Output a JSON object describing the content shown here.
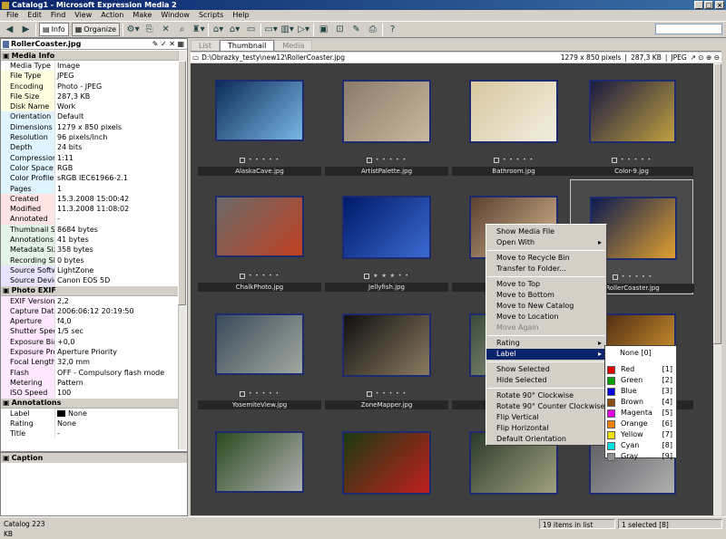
{
  "window": {
    "title": "Catalog1 - Microsoft Expression Media 2"
  },
  "menu": [
    "File",
    "Edit",
    "Find",
    "View",
    "Action",
    "Make",
    "Window",
    "Scripts",
    "Help"
  ],
  "toolbar": {
    "info_label": "Info",
    "organize_label": "Organize"
  },
  "panel": {
    "title": "RollerCoaster.jpg",
    "media_info_title": "Media Info",
    "media_info": [
      {
        "k": "Media Type",
        "v": "Image",
        "c": "#ffffff"
      },
      {
        "k": "File Type",
        "v": "JPEG",
        "c": "#ffffe0"
      },
      {
        "k": "Encoding",
        "v": "Photo - JPEG",
        "c": "#ffffe0"
      },
      {
        "k": "File Size",
        "v": "287,3 KB",
        "c": "#ffffe0"
      },
      {
        "k": "Disk Name",
        "v": "Work",
        "c": "#ffffe0"
      },
      {
        "k": "Orientation",
        "v": "Default",
        "c": "#e0f4ff"
      },
      {
        "k": "Dimensions",
        "v": "1279 x 850 pixels",
        "c": "#e0f4ff"
      },
      {
        "k": "Resolution",
        "v": "96 pixels/inch",
        "c": "#e0f4ff"
      },
      {
        "k": "Depth",
        "v": "24 bits",
        "c": "#e0f4ff"
      },
      {
        "k": "Compression",
        "v": "1:11",
        "c": "#e0f4ff"
      },
      {
        "k": "Color Space",
        "v": "RGB",
        "c": "#e0f4ff"
      },
      {
        "k": "Color Profile",
        "v": "sRGB IEC61966-2.1",
        "c": "#e0f4ff"
      },
      {
        "k": "Pages",
        "v": "1",
        "c": "#e0f4ff"
      },
      {
        "k": "Created",
        "v": "15.3.2008 15:00:42",
        "c": "#ffe4e4"
      },
      {
        "k": "Modified",
        "v": "11.3.2008 11:08:02",
        "c": "#ffe4e4"
      },
      {
        "k": "Annotated",
        "v": "-",
        "c": "#ffe4e4"
      },
      {
        "k": "Thumbnail Size",
        "v": "8684 bytes",
        "c": "#e4f4e4"
      },
      {
        "k": "Annotations Size",
        "v": "41 bytes",
        "c": "#e4f4e4"
      },
      {
        "k": "Metadata Size",
        "v": "358 bytes",
        "c": "#e4f4e4"
      },
      {
        "k": "Recording Size",
        "v": "0 bytes",
        "c": "#e4f4e4"
      },
      {
        "k": "Source Softw...",
        "v": "LightZone",
        "c": "#e8e4ff"
      },
      {
        "k": "Source Device",
        "v": "Canon EOS 5D",
        "c": "#e8e4ff"
      }
    ],
    "photo_exif_title": "Photo EXIF",
    "photo_exif": [
      {
        "k": "EXIF Version",
        "v": "2,2",
        "c": "#ffe8ff"
      },
      {
        "k": "Capture Date",
        "v": "2006:06:12 20:19:50",
        "c": "#ffe8ff"
      },
      {
        "k": "Aperture",
        "v": "f4,0",
        "c": "#ffe8ff"
      },
      {
        "k": "Shutter Speed",
        "v": "1/5 sec",
        "c": "#ffe8ff"
      },
      {
        "k": "Exposure Bias",
        "v": "+0,0",
        "c": "#ffe8ff"
      },
      {
        "k": "Exposure Prog...",
        "v": "Aperture Priority",
        "c": "#ffe8ff"
      },
      {
        "k": "Focal Length",
        "v": "32,0 mm",
        "c": "#ffe8ff"
      },
      {
        "k": "Flash",
        "v": "OFF - Compulsory flash mode",
        "c": "#ffe8ff"
      },
      {
        "k": "Metering",
        "v": "Pattern",
        "c": "#ffe8ff"
      },
      {
        "k": "ISO Speed",
        "v": "100",
        "c": "#ffe8ff"
      }
    ],
    "annotations_title": "Annotations",
    "annotations": [
      {
        "k": "Label",
        "v": "None",
        "c": "#ffffff"
      },
      {
        "k": "Rating",
        "v": "None",
        "c": "#ffffff"
      },
      {
        "k": "Title",
        "v": "-",
        "c": "#ffffff"
      }
    ],
    "caption_title": "Caption"
  },
  "tabs": [
    "List",
    "Thumbnail",
    "Media"
  ],
  "pathbar": {
    "path": "D:\\Obrazky_testy\\new12\\RollerCoaster.jpg",
    "dims": "1279 x 850 pixels",
    "size": "287,3 KB",
    "type": "JPEG"
  },
  "thumbs": [
    {
      "name": "AlaskaCave.jpg",
      "c1": "#0c2c58",
      "c2": "#79b7e6",
      "stars": "• • • • •"
    },
    {
      "name": "ArtistPalette.jpg",
      "c1": "#8a7a6a",
      "c2": "#c9b9a0",
      "stars": "• • • • •"
    },
    {
      "name": "Bathroom.jpg",
      "c1": "#d8c8a0",
      "c2": "#f2eee0",
      "stars": "• • • • •"
    },
    {
      "name": "Color-9.jpg",
      "c1": "#1a1a40",
      "c2": "#c0a040",
      "stars": "• • • • •"
    },
    {
      "name": "ChalkPhoto.jpg",
      "c1": "#6a6a6a",
      "c2": "#c04020",
      "stars": "• • • • •"
    },
    {
      "name": "Jellyfish.jpg",
      "c1": "#001a6a",
      "c2": "#3a6ad0",
      "stars": "★ ★ ★ • •"
    },
    {
      "name": "",
      "c1": "#5a4030",
      "c2": "#d8b890",
      "stars": "• • • • •"
    },
    {
      "name": "RollerCoaster.jpg",
      "c1": "#0a1a50",
      "c2": "#e0a030",
      "stars": "• • • • •"
    },
    {
      "name": "YosemiteView.jpg",
      "c1": "#3a4a5a",
      "c2": "#a0a8a0",
      "stars": "• • • • •"
    },
    {
      "name": "ZoneMapper.jpg",
      "c1": "#101010",
      "c2": "#8a7a60",
      "stars": "• • • • •"
    },
    {
      "name": "",
      "c1": "#3a4a3a",
      "c2": "#a0a890",
      "stars": "• • • • •"
    },
    {
      "name": "",
      "c1": "#402010",
      "c2": "#e0a030",
      "stars": "• • • • •"
    },
    {
      "name": "",
      "c1": "#2a4a20",
      "c2": "#b0b0b0",
      "stars": ""
    },
    {
      "name": "",
      "c1": "#1a3a10",
      "c2": "#c02020",
      "stars": ""
    },
    {
      "name": "",
      "c1": "#2a3a2a",
      "c2": "#a0a080",
      "stars": ""
    },
    {
      "name": "",
      "c1": "#5a5a60",
      "c2": "#b0b0b0",
      "stars": ""
    }
  ],
  "context_menu": [
    {
      "label": "Show Media File"
    },
    {
      "label": "Open With",
      "sub": true
    },
    {
      "sep": true
    },
    {
      "label": "Move to Recycle Bin"
    },
    {
      "label": "Transfer to Folder..."
    },
    {
      "sep": true
    },
    {
      "label": "Move to Top"
    },
    {
      "label": "Move to Bottom"
    },
    {
      "label": "Move to New Catalog"
    },
    {
      "label": "Move to Location"
    },
    {
      "label": "Move Again",
      "disabled": true
    },
    {
      "sep": true
    },
    {
      "label": "Rating",
      "sub": true
    },
    {
      "label": "Label",
      "sub": true,
      "hi": true
    },
    {
      "sep": true
    },
    {
      "label": "Show Selected"
    },
    {
      "label": "Hide Selected"
    },
    {
      "sep": true
    },
    {
      "label": "Rotate 90° Clockwise"
    },
    {
      "label": "Rotate 90° Counter Clockwise"
    },
    {
      "label": "Flip Vertical"
    },
    {
      "label": "Flip Horizontal"
    },
    {
      "label": "Default Orientation"
    }
  ],
  "label_menu": [
    {
      "label": "None [0]",
      "color": ""
    },
    {
      "label": "Red",
      "key": "[1]",
      "color": "#e00000"
    },
    {
      "label": "Green",
      "key": "[2]",
      "color": "#00a000"
    },
    {
      "label": "Blue",
      "key": "[3]",
      "color": "#0000e0"
    },
    {
      "label": "Brown",
      "key": "[4]",
      "color": "#8a4a10"
    },
    {
      "label": "Magenta",
      "key": "[5]",
      "color": "#e000e0"
    },
    {
      "label": "Orange",
      "key": "[6]",
      "color": "#f08000"
    },
    {
      "label": "Yellow",
      "key": "[7]",
      "color": "#f0e000"
    },
    {
      "label": "Cyan",
      "key": "[8]",
      "color": "#00e0e0"
    },
    {
      "label": "Gray",
      "key": "[9]",
      "color": "#909090"
    }
  ],
  "status": {
    "left": "Catalog  223 KB",
    "count": "19 items in list",
    "selected": "1 selected [8]"
  }
}
